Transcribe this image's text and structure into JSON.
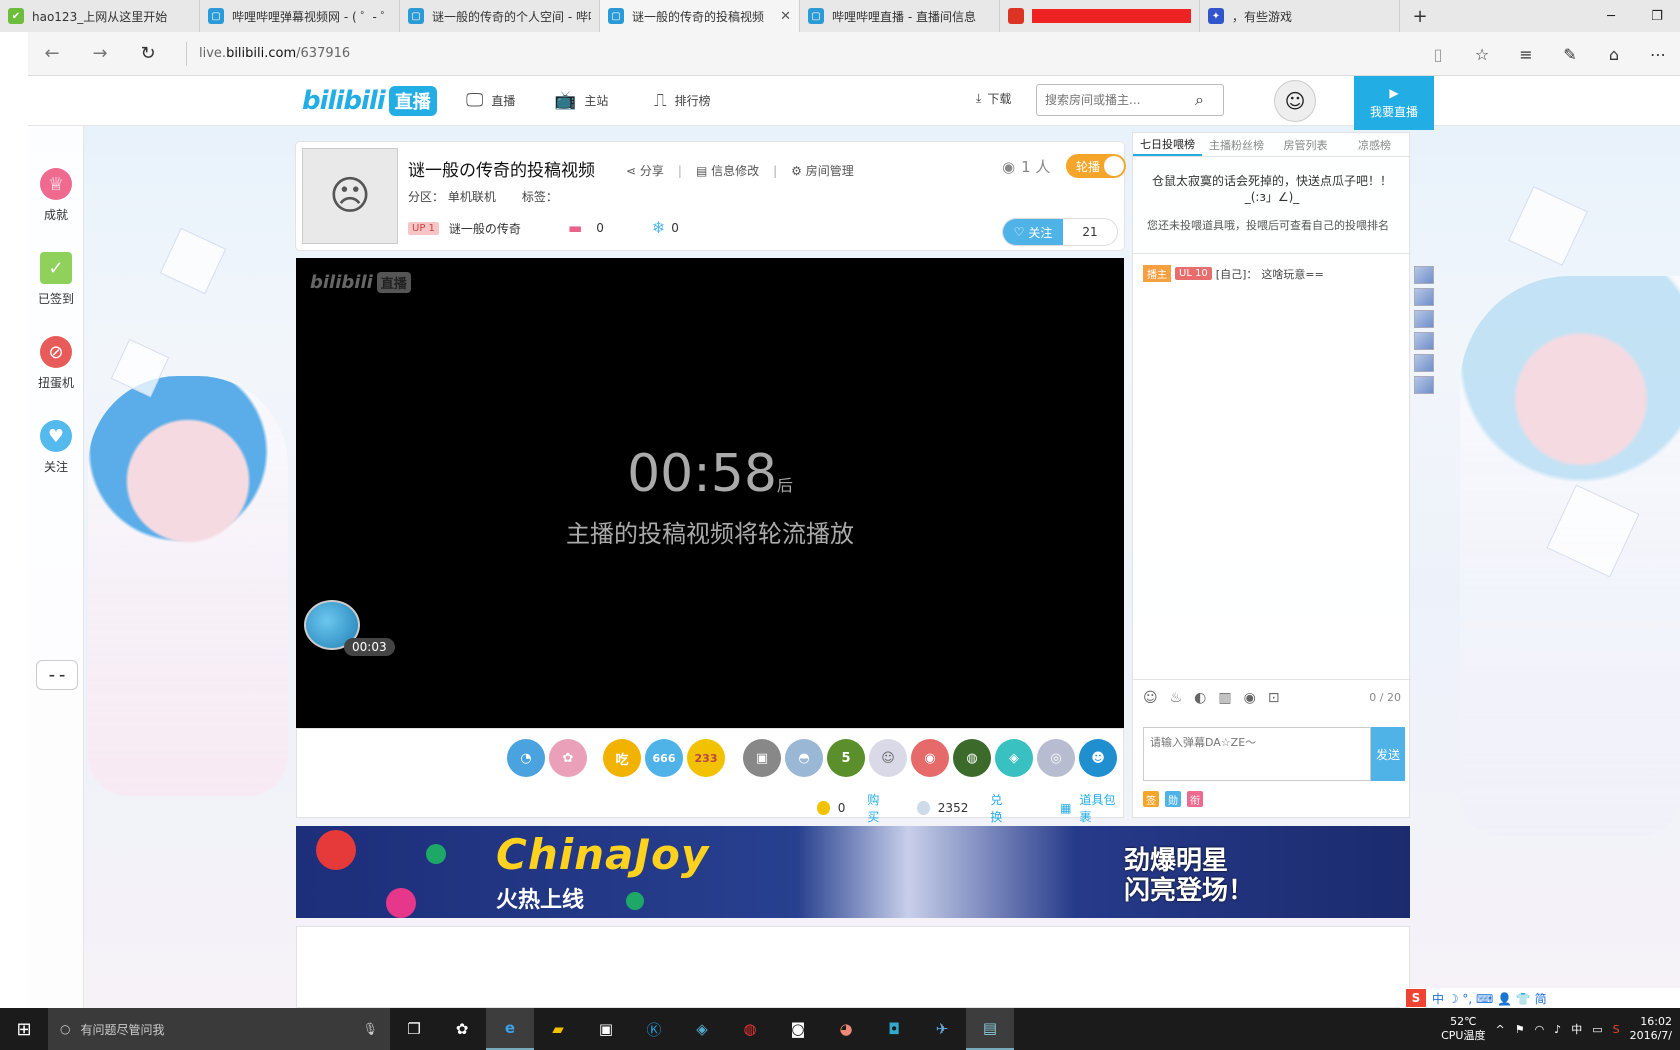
{
  "browser": {
    "tabs": [
      {
        "label": "hao123_上网从这里开始",
        "icon": "hao123-icon",
        "close": "",
        "active": false
      },
      {
        "label": "哔哩哔哩弹幕视频网 - ( ゜- ゜)",
        "icon": "bilibili-icon",
        "close": "",
        "active": false
      },
      {
        "label": "谜一般的传奇的个人空间 - 哔哩哔哩",
        "icon": "bilibili-icon",
        "close": "",
        "active": false
      },
      {
        "label": "谜一般的传奇的投稿视频",
        "icon": "bilibili-icon",
        "close": "✕",
        "active": true
      },
      {
        "label": "哔哩哔哩直播 - 直播间信息",
        "icon": "bilibili-icon",
        "close": "",
        "active": false
      },
      {
        "label": "",
        "icon": "redacted-icon",
        "close": "",
        "active": false
      },
      {
        "label": "，有些游戏",
        "icon": "baidu-icon",
        "close": "",
        "active": false
      }
    ],
    "new_tab": "+",
    "address": {
      "prefix": "live.",
      "domain": "bilibili.com",
      "path": "/637916"
    }
  },
  "site": {
    "logo_text": "bilibili",
    "logo_badge": "直播",
    "nav": [
      {
        "label": "直播",
        "icon": "monitor-icon"
      },
      {
        "label": "主站",
        "icon": "tv-icon"
      },
      {
        "label": "排行榜",
        "icon": "chart-icon"
      }
    ],
    "download": "下载",
    "search_placeholder": "搜索房间或播主...",
    "go_live": "我要直播"
  },
  "sidebar": {
    "items": [
      {
        "label": "成就",
        "icon": "trophy-icon",
        "color": "#ef6a8f"
      },
      {
        "label": "已签到",
        "icon": "checkin-icon",
        "color": "#8fd15a"
      },
      {
        "label": "扭蛋机",
        "icon": "gacha-icon",
        "color": "#e85b5b"
      },
      {
        "label": "关注",
        "icon": "heart-icon",
        "color": "#54b9ec"
      }
    ],
    "toggle": "– –"
  },
  "room": {
    "title": "谜一般の传奇的投稿视频",
    "actions": [
      "分享",
      "信息修改",
      "房间管理"
    ],
    "category_label": "分区：",
    "category": "单机联机",
    "tags_label": "标签：",
    "owner_badge": "UP 1",
    "owner_name": "谜一般の传奇",
    "gift_count": "0",
    "snow_count": "0",
    "viewers": "1 人",
    "rotation": "轮播",
    "follow_label": "关注",
    "follow_count": "21"
  },
  "player": {
    "logo_text": "bilibili",
    "logo_badge": "直播",
    "countdown": "00:58",
    "countdown_suffix": "后",
    "message": "主播的投稿视频将轮流播放",
    "chest_time": "00:03"
  },
  "gifts": {
    "items": [
      {
        "name": "gift-1",
        "text": "◔",
        "color": "#4aa3df"
      },
      {
        "name": "gift-2",
        "text": "✿",
        "color": "#e9a0b8"
      },
      {
        "name": "gift-3",
        "text": "吃",
        "color": "#f2b200"
      },
      {
        "name": "gift-4",
        "text": "666",
        "color": "#4fb3e8"
      },
      {
        "name": "gift-5",
        "text": "233",
        "color": "#f2c200"
      },
      {
        "name": "gift-6",
        "text": "▣",
        "color": "#888888"
      },
      {
        "name": "gift-7",
        "text": "◓",
        "color": "#9ab8d6"
      },
      {
        "name": "gift-8",
        "text": "5",
        "color": "#5a8f2c"
      },
      {
        "name": "gift-9",
        "text": "☺",
        "color": "#d9d9e8"
      },
      {
        "name": "gift-10",
        "text": "◉",
        "color": "#e66a6a"
      },
      {
        "name": "gift-11",
        "text": "◍",
        "color": "#3b6a2a"
      },
      {
        "name": "gift-12",
        "text": "◈",
        "color": "#39c1c1"
      },
      {
        "name": "gift-13",
        "text": "◎",
        "color": "#b7bcd0"
      },
      {
        "name": "gift-14",
        "text": "☻",
        "color": "#1f8fd0"
      }
    ],
    "gold": "0",
    "buy": "购买",
    "silver": "2352",
    "exchange": "兑换",
    "bag": "道具包裹"
  },
  "banner": {
    "title": "ChinaJoy",
    "subtitle": "火热上线",
    "right_line1": "劲爆明星",
    "right_line2": "闪亮登场！"
  },
  "panel": {
    "tabs": [
      "七日投喂榜",
      "主播粉丝榜",
      "房管列表",
      "凉感榜"
    ],
    "rank_message": "仓鼠太寂寞的话会死掉的，快送点瓜子吧！！_(:з」∠)_",
    "rank_hint": "您还未投喂道具哦，投喂后可查看自己的投喂排名",
    "chat": {
      "host_badge": "播主",
      "level_badge": "UL 10",
      "user": "[自己]：",
      "text": "这啥玩意=="
    },
    "tool_icons": [
      "smile-icon",
      "fire-icon",
      "palette-icon",
      "trash-icon",
      "record-icon",
      "block-icon"
    ],
    "char_count": "0 / 20",
    "input_placeholder": "请输入弹幕DA☆ZE～",
    "send": "发送",
    "mini_badges": [
      {
        "text": "签",
        "color": "#f6a52b"
      },
      {
        "text": "勋",
        "color": "#4fb3e8"
      },
      {
        "text": "衔",
        "color": "#ef6a8f"
      }
    ]
  },
  "ime": {
    "text": "中 ☽ °, ⌨ 👤 👕 简"
  },
  "taskbar": {
    "search_text": "有问题尽管问我",
    "temperature": "52℃",
    "cpu_label": "CPU温度",
    "lang": "中",
    "time": "16:02",
    "date": "2016/7/"
  }
}
